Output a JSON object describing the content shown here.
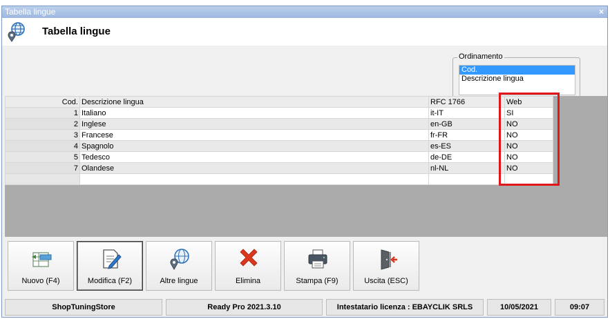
{
  "window": {
    "title": "Tabella lingue",
    "close_label": "×"
  },
  "header": {
    "title": "Tabella lingue",
    "icon": "globe-location-icon"
  },
  "ordering": {
    "legend": "Ordinamento",
    "options": [
      "Cod.",
      "Descrizione lingua"
    ],
    "selected": "Cod."
  },
  "grid": {
    "columns": {
      "cod": "Cod.",
      "desc": "Descrizione lingua",
      "rfc": "RFC 1766",
      "web": "Web"
    },
    "rows": [
      {
        "cod": "1",
        "desc": "Italiano",
        "rfc": "it-IT",
        "web": "SI"
      },
      {
        "cod": "2",
        "desc": "Inglese",
        "rfc": "en-GB",
        "web": "NO"
      },
      {
        "cod": "3",
        "desc": "Francese",
        "rfc": "fr-FR",
        "web": "NO"
      },
      {
        "cod": "4",
        "desc": "Spagnolo",
        "rfc": "es-ES",
        "web": "NO"
      },
      {
        "cod": "5",
        "desc": "Tedesco",
        "rfc": "de-DE",
        "web": "NO"
      },
      {
        "cod": "7",
        "desc": "Olandese",
        "rfc": "nl-NL",
        "web": "NO"
      }
    ],
    "highlight_color": "#e0161b"
  },
  "toolbar": {
    "new": {
      "label": "Nuovo (F4)",
      "icon": "new-row-icon"
    },
    "edit": {
      "label": "Modifica (F2)",
      "icon": "edit-document-icon"
    },
    "other_languages": {
      "label": "Altre lingue",
      "icon": "globe-icon"
    },
    "delete": {
      "label": "Elimina",
      "icon": "delete-x-icon"
    },
    "print": {
      "label": "Stampa (F9)",
      "icon": "printer-icon"
    },
    "exit": {
      "label": "Uscita (ESC)",
      "icon": "exit-door-icon"
    }
  },
  "status": {
    "store": "ShopTuningStore",
    "version": "Ready Pro 2021.3.10",
    "license": "Intestatario licenza : EBAYCLIK SRLS",
    "date": "10/05/2021",
    "time": "09:07"
  }
}
